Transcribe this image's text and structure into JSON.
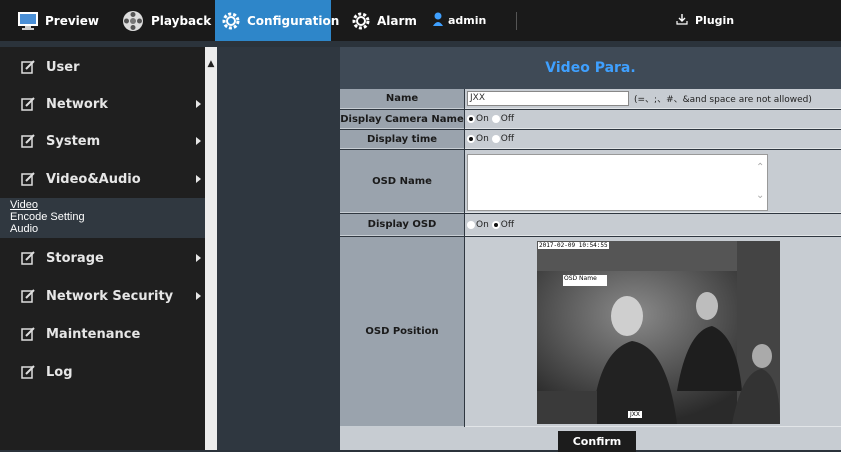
{
  "topbar": {
    "tabs": [
      {
        "label": "Preview",
        "icon": "monitor-icon"
      },
      {
        "label": "Playback",
        "icon": "film-reel-icon"
      },
      {
        "label": "Configuration",
        "icon": "gear-icon",
        "active": true
      },
      {
        "label": "Alarm",
        "icon": "gear-icon"
      }
    ],
    "user": "admin",
    "plugin": "Plugin"
  },
  "sidebar": {
    "items": [
      {
        "label": "User"
      },
      {
        "label": "Network"
      },
      {
        "label": "System"
      },
      {
        "label": "Video&Audio"
      },
      {
        "label": "Storage"
      },
      {
        "label": "Network Security"
      },
      {
        "label": "Maintenance"
      },
      {
        "label": "Log"
      }
    ],
    "submenu": [
      "Video",
      "Encode Setting",
      "Audio"
    ]
  },
  "page": {
    "title": "Video Para.",
    "rows": {
      "name_label": "Name",
      "name_value": "JXX",
      "name_hint": "(=、;、#、&and space are not allowed)",
      "display_camera_name_label": "Display Camera Name",
      "display_time_label": "Display time",
      "osd_name_label": "OSD Name",
      "osd_name_value": "",
      "display_osd_label": "Display OSD",
      "osd_position_label": "OSD Position",
      "on_label": "On",
      "off_label": "Off"
    },
    "preview": {
      "timestamp": "2017-02-09 10:54:55",
      "osd_name": "OSD Name",
      "camera_name": "JXX"
    },
    "confirm_label": "Confirm"
  },
  "colors": {
    "accent": "#2e86c9",
    "title_text": "#3fa0ff",
    "topbar_bg": "#1a1a1a",
    "sidebar_bg": "#1f1f1f"
  }
}
